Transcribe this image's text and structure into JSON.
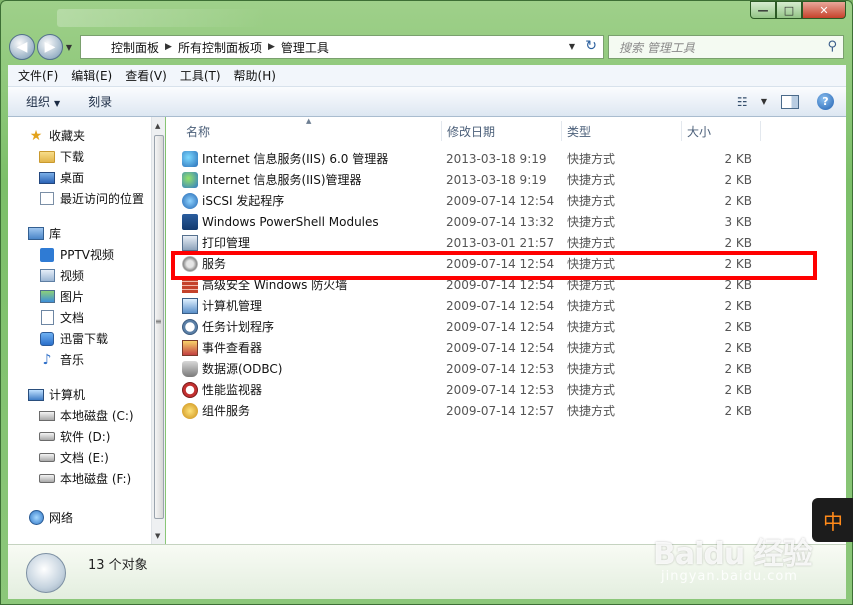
{
  "window": {
    "caption_buttons": {
      "minimize": "—",
      "maximize": "□",
      "close": "✕"
    }
  },
  "nav_buttons": {
    "back": "◀",
    "forward": "▶",
    "recent": "▼"
  },
  "address": {
    "crumbs": [
      "控制面板",
      "所有控制面板项",
      "管理工具"
    ],
    "dropdown": "▼",
    "refresh": "↻"
  },
  "search": {
    "placeholder": "搜索 管理工具",
    "icon": "search-icon"
  },
  "menu": [
    "文件(F)",
    "编辑(E)",
    "查看(V)",
    "工具(T)",
    "帮助(H)"
  ],
  "toolbar": {
    "organize": "组织",
    "burn": "刻录",
    "help": "?"
  },
  "nav": {
    "favorites": {
      "label": "收藏夹",
      "items": [
        "下载",
        "桌面",
        "最近访问的位置"
      ]
    },
    "libraries": {
      "label": "库",
      "items": [
        "PPTV视频",
        "视频",
        "图片",
        "文档",
        "迅雷下载",
        "音乐"
      ]
    },
    "computer": {
      "label": "计算机",
      "items": [
        "本地磁盘 (C:)",
        "软件 (D:)",
        "文档 (E:)",
        "本地磁盘 (F:)"
      ]
    },
    "network": {
      "label": "网络"
    }
  },
  "columns": {
    "name": "名称",
    "date": "修改日期",
    "type": "类型",
    "size": "大小"
  },
  "files": [
    {
      "name": "Internet 信息服务(IIS) 6.0 管理器",
      "date": "2013-03-18 9:19",
      "type": "快捷方式",
      "size": "2 KB",
      "icon": "iis6"
    },
    {
      "name": "Internet 信息服务(IIS)管理器",
      "date": "2013-03-18 9:19",
      "type": "快捷方式",
      "size": "2 KB",
      "icon": "iis"
    },
    {
      "name": "iSCSI 发起程序",
      "date": "2009-07-14 12:54",
      "type": "快捷方式",
      "size": "2 KB",
      "icon": "iscsi"
    },
    {
      "name": "Windows PowerShell Modules",
      "date": "2009-07-14 13:32",
      "type": "快捷方式",
      "size": "3 KB",
      "icon": "ps"
    },
    {
      "name": "打印管理",
      "date": "2013-03-01 21:57",
      "type": "快捷方式",
      "size": "2 KB",
      "icon": "print"
    },
    {
      "name": "服务",
      "date": "2009-07-14 12:54",
      "type": "快捷方式",
      "size": "2 KB",
      "icon": "service"
    },
    {
      "name": "高级安全 Windows 防火墙",
      "date": "2009-07-14 12:54",
      "type": "快捷方式",
      "size": "2 KB",
      "icon": "firewall"
    },
    {
      "name": "计算机管理",
      "date": "2009-07-14 12:54",
      "type": "快捷方式",
      "size": "2 KB",
      "icon": "computer"
    },
    {
      "name": "任务计划程序",
      "date": "2009-07-14 12:54",
      "type": "快捷方式",
      "size": "2 KB",
      "icon": "task"
    },
    {
      "name": "事件查看器",
      "date": "2009-07-14 12:54",
      "type": "快捷方式",
      "size": "2 KB",
      "icon": "event"
    },
    {
      "name": "数据源(ODBC)",
      "date": "2009-07-14 12:53",
      "type": "快捷方式",
      "size": "2 KB",
      "icon": "odbc"
    },
    {
      "name": "性能监视器",
      "date": "2009-07-14 12:53",
      "type": "快捷方式",
      "size": "2 KB",
      "icon": "perf"
    },
    {
      "name": "组件服务",
      "date": "2009-07-14 12:57",
      "type": "快捷方式",
      "size": "2 KB",
      "icon": "comp"
    }
  ],
  "highlighted_item": "服务",
  "highlight_color": "#ff0000",
  "status": {
    "count": "13 个对象"
  },
  "ime": {
    "label": "中"
  },
  "watermark": {
    "brand": "Baidu 经验",
    "url": "jingyan.baidu.com"
  }
}
